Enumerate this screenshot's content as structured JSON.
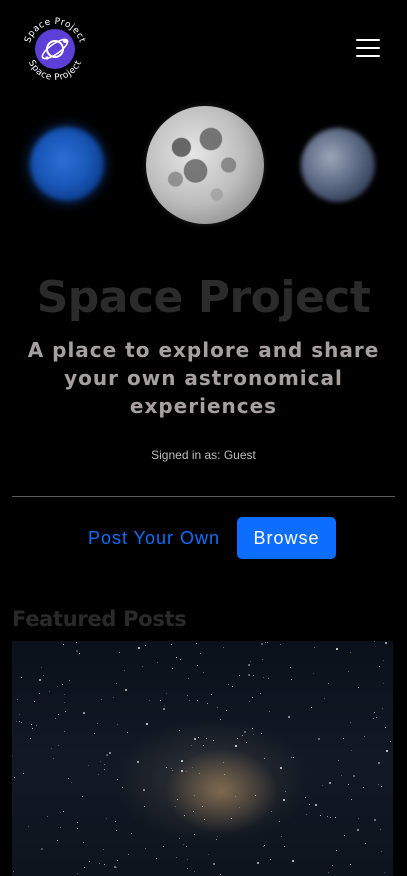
{
  "header": {
    "logo_icon": "space-project-logo-icon",
    "logo_text_top": "Space Project",
    "logo_text_bottom": "Space Project",
    "menu_icon": "hamburger-menu-icon"
  },
  "hero": {
    "planets": [
      "blue-planet-image",
      "moon-image",
      "earth-image"
    ],
    "title": "Space Project",
    "subtitle": "A place to explore and share your own astronomical experiences",
    "signed_in": "Signed in as: Guest"
  },
  "actions": {
    "post_label": "Post Your Own",
    "browse_label": "Browse"
  },
  "featured": {
    "heading": "Featured Posts",
    "image": "milky-way-image"
  },
  "colors": {
    "accent": "#0d6efd",
    "background": "#000000",
    "logo_purple": "#5b3fd6"
  }
}
